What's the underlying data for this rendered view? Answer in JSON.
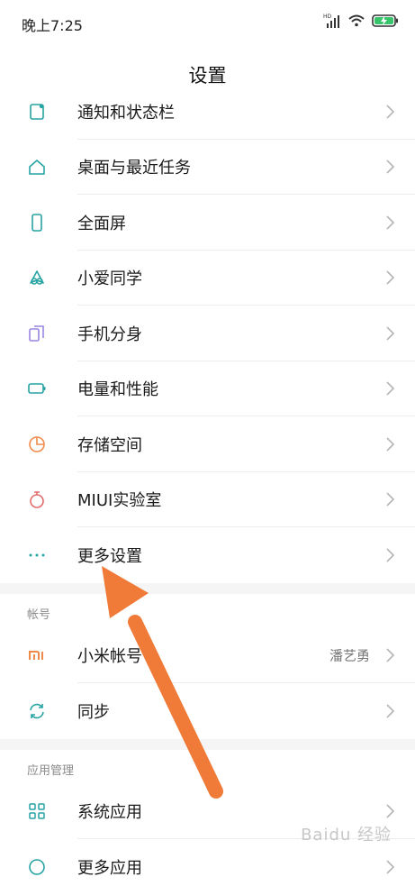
{
  "status_bar": {
    "time": "晚上7:25",
    "network": "HD"
  },
  "page_title": "设置",
  "top_items": [
    {
      "label": "通知和状态栏",
      "icon": "notification-icon"
    },
    {
      "label": "桌面与最近任务",
      "icon": "home-icon"
    },
    {
      "label": "全面屏",
      "icon": "phone-screen-icon"
    },
    {
      "label": "小爱同学",
      "icon": "xiaoai-icon"
    },
    {
      "label": "手机分身",
      "icon": "dual-phone-icon"
    },
    {
      "label": "电量和性能",
      "icon": "battery-icon"
    },
    {
      "label": "存储空间",
      "icon": "storage-pie-icon"
    },
    {
      "label": "MIUI实验室",
      "icon": "lab-flask-icon"
    },
    {
      "label": "更多设置",
      "icon": "more-dots-icon"
    }
  ],
  "account_section": {
    "title": "帐号",
    "items": [
      {
        "label": "小米帐号",
        "value": "潘艺勇",
        "icon": "mi-logo-icon"
      },
      {
        "label": "同步",
        "icon": "sync-icon"
      }
    ]
  },
  "apps_section": {
    "title": "应用管理",
    "items": [
      {
        "label": "系统应用",
        "icon": "grid-apps-icon"
      },
      {
        "label": "更多应用",
        "icon": "more-apps-icon"
      }
    ]
  },
  "watermark": "Baidu 经验",
  "colors": {
    "icon_teal": "#27a3a3",
    "icon_purple": "#9a85e0",
    "icon_orange": "#f08a4b",
    "icon_red": "#e26b6b",
    "arrow": "#f07a37"
  }
}
